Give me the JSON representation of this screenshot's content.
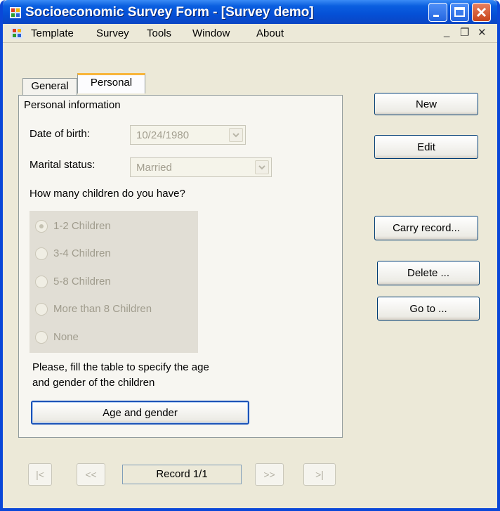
{
  "window": {
    "title": "Socioeconomic Survey Form - [Survey demo]"
  },
  "menu": {
    "items": [
      "Template",
      "Survey",
      "Tools",
      "Window",
      "About"
    ],
    "mdi_controls": [
      "_",
      "❐",
      "✕"
    ]
  },
  "tabs": [
    {
      "label": "General",
      "selected": false
    },
    {
      "label": "Personal",
      "selected": true
    }
  ],
  "personal": {
    "group_title": "Personal information",
    "dob_label": "Date of birth:",
    "dob_value": "10/24/1980",
    "marital_label": "Marital status:",
    "marital_value": "Married",
    "children_question": "How many children do you have?",
    "children_options": [
      {
        "label": "1-2 Children",
        "selected": true
      },
      {
        "label": "3-4 Children",
        "selected": false
      },
      {
        "label": "5-8 Children",
        "selected": false
      },
      {
        "label": "More than 8 Children",
        "selected": false
      },
      {
        "label": "None",
        "selected": false
      }
    ],
    "fill_table_note_line1": "Please, fill the table to specify the age",
    "fill_table_note_line2": "and gender of the children",
    "age_gender_button": "Age and gender"
  },
  "actions": {
    "new": "New",
    "edit": "Edit",
    "carry_record": "Carry record...",
    "delete": "Delete ...",
    "go_to": "Go to ..."
  },
  "navigation": {
    "first": "|<",
    "prev": "<<",
    "record_label": "Record 1/1",
    "next": ">>",
    "last": ">|"
  }
}
